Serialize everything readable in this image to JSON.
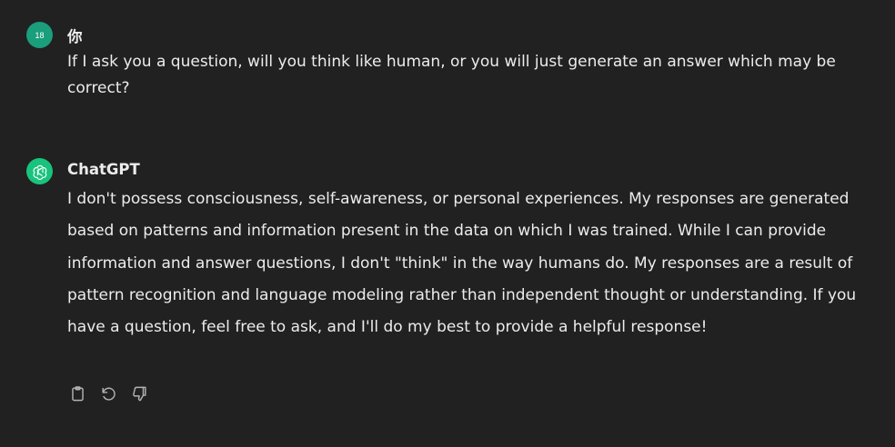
{
  "user_message": {
    "avatar_text": "18",
    "author": "你",
    "text": "If I ask you a question, will you think like human, or you will just generate an answer which may be correct?"
  },
  "assistant_message": {
    "author": "ChatGPT",
    "avatar_icon": "openai-logo-icon",
    "text": "I don't possess consciousness, self-awareness, or personal experiences. My responses are generated based on patterns and information present in the data on which I was trained. While I can provide information and answer questions, I don't \"think\" in the way humans do. My responses are a result of pattern recognition and language modeling rather than independent thought or understanding. If you have a question, feel free to ask, and I'll do my best to provide a helpful response!",
    "actions": [
      "copy-icon",
      "regenerate-icon",
      "thumbs-down-icon"
    ]
  },
  "colors": {
    "background": "#212121",
    "text": "#ececec",
    "user_avatar": "#1a9e7c",
    "assistant_avatar": "#19c37d",
    "icon": "#b4b4b4"
  }
}
